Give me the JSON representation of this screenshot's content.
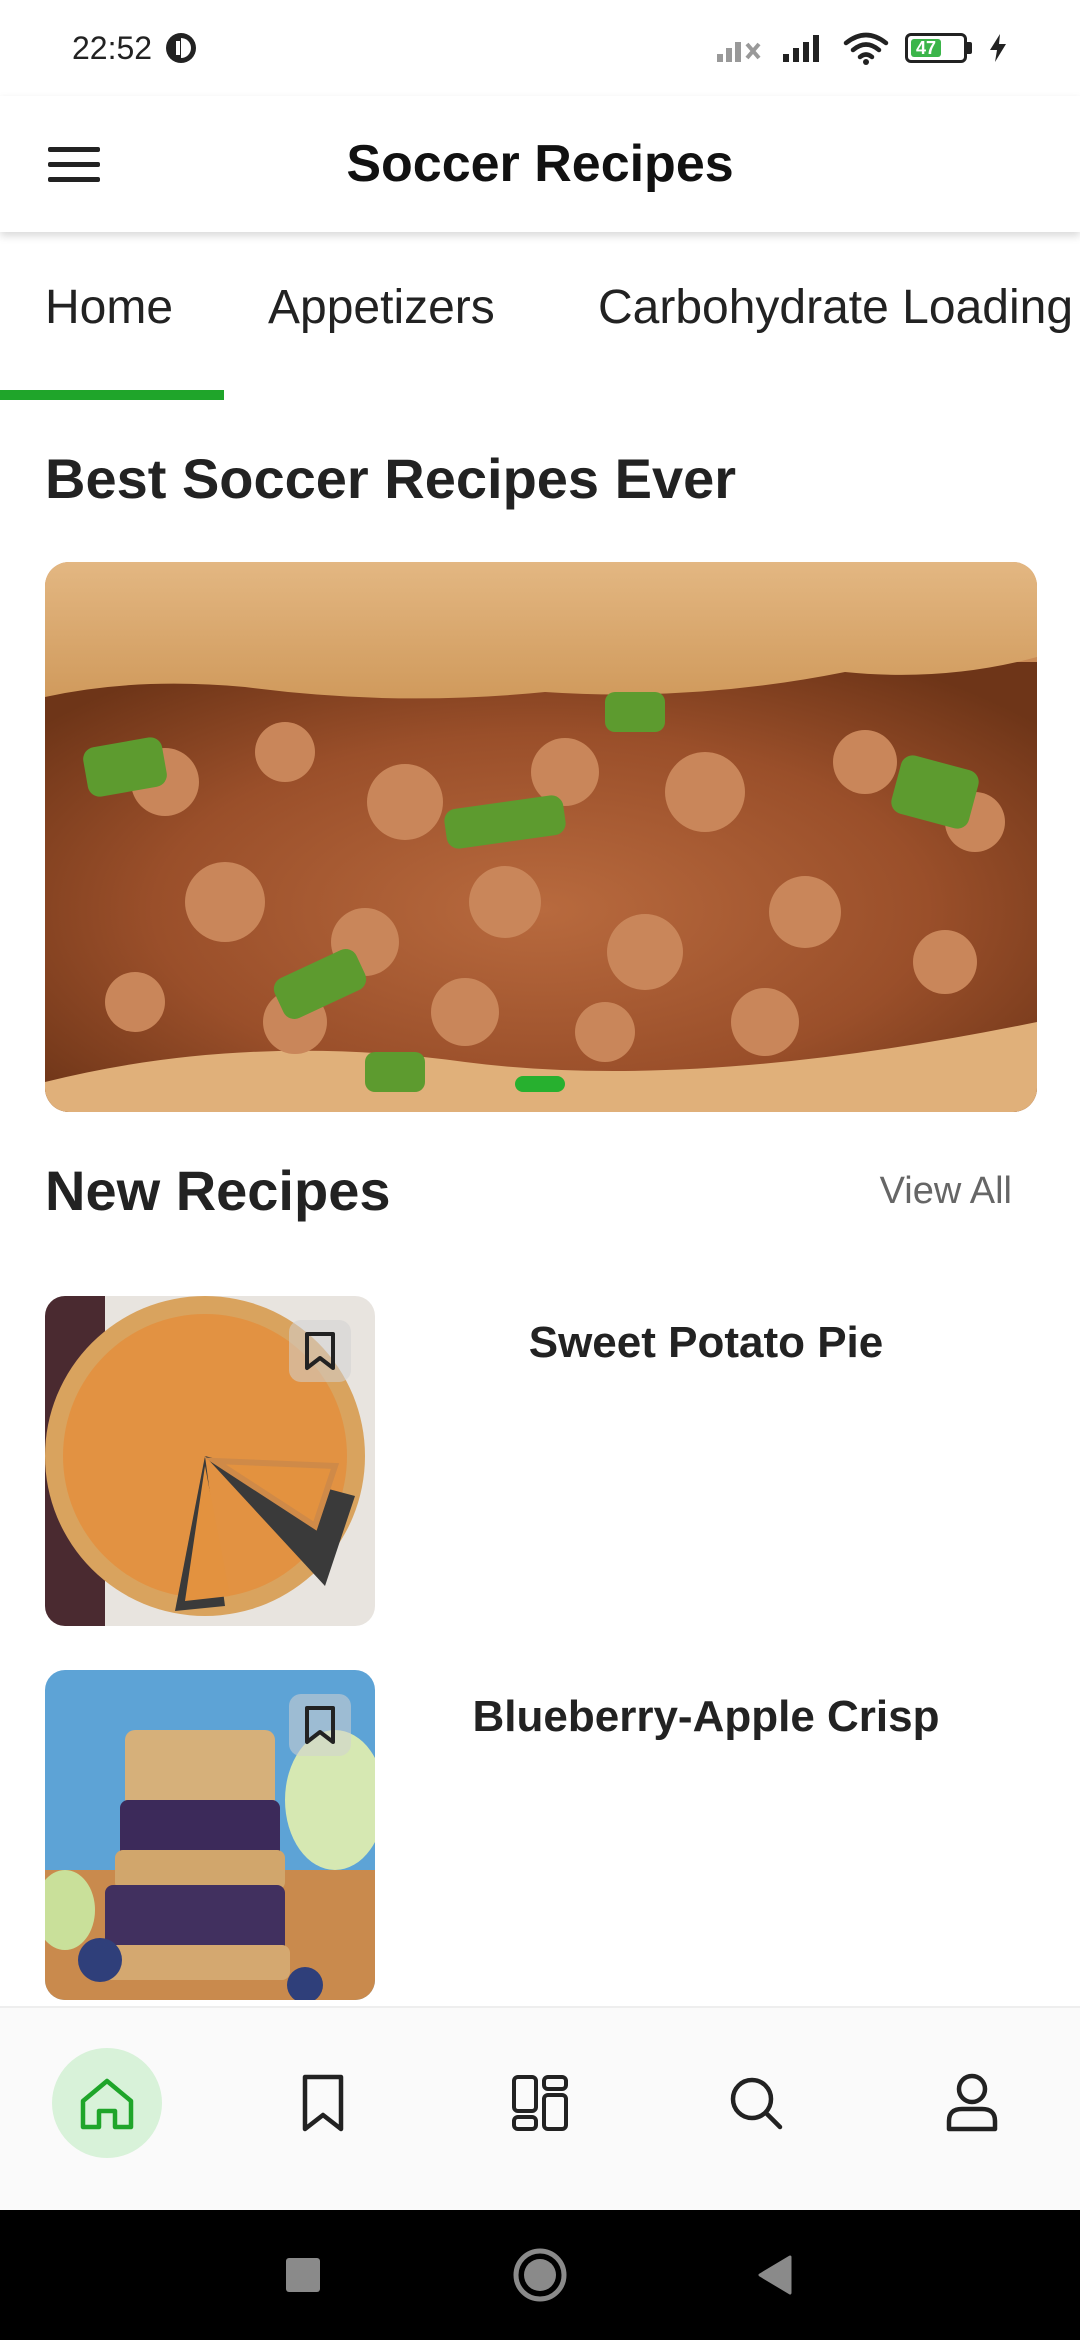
{
  "status_bar": {
    "time": "22:52",
    "battery": "47"
  },
  "app_bar": {
    "title": "Soccer Recipes"
  },
  "tabs": [
    {
      "label": "Home",
      "active": true
    },
    {
      "label": "Appetizers",
      "active": false
    },
    {
      "label": "Carbohydrate Loading",
      "active": false
    }
  ],
  "featured": {
    "heading": "Best Soccer Recipes Ever",
    "active_dot": 1
  },
  "new_recipes": {
    "heading": "New Recipes",
    "view_all_label": "View All",
    "items": [
      {
        "title": "Sweet Potato Pie"
      },
      {
        "title": "Blueberry-Apple Crisp"
      }
    ]
  },
  "bottom_nav": {
    "items": [
      {
        "icon": "home-icon",
        "active": true
      },
      {
        "icon": "bookmark-icon",
        "active": false
      },
      {
        "icon": "categories-icon",
        "active": false
      },
      {
        "icon": "search-icon",
        "active": false
      },
      {
        "icon": "profile-icon",
        "active": false
      }
    ]
  },
  "colors": {
    "accent": "#1fa52a",
    "accent_light": "#d8f2d9"
  }
}
